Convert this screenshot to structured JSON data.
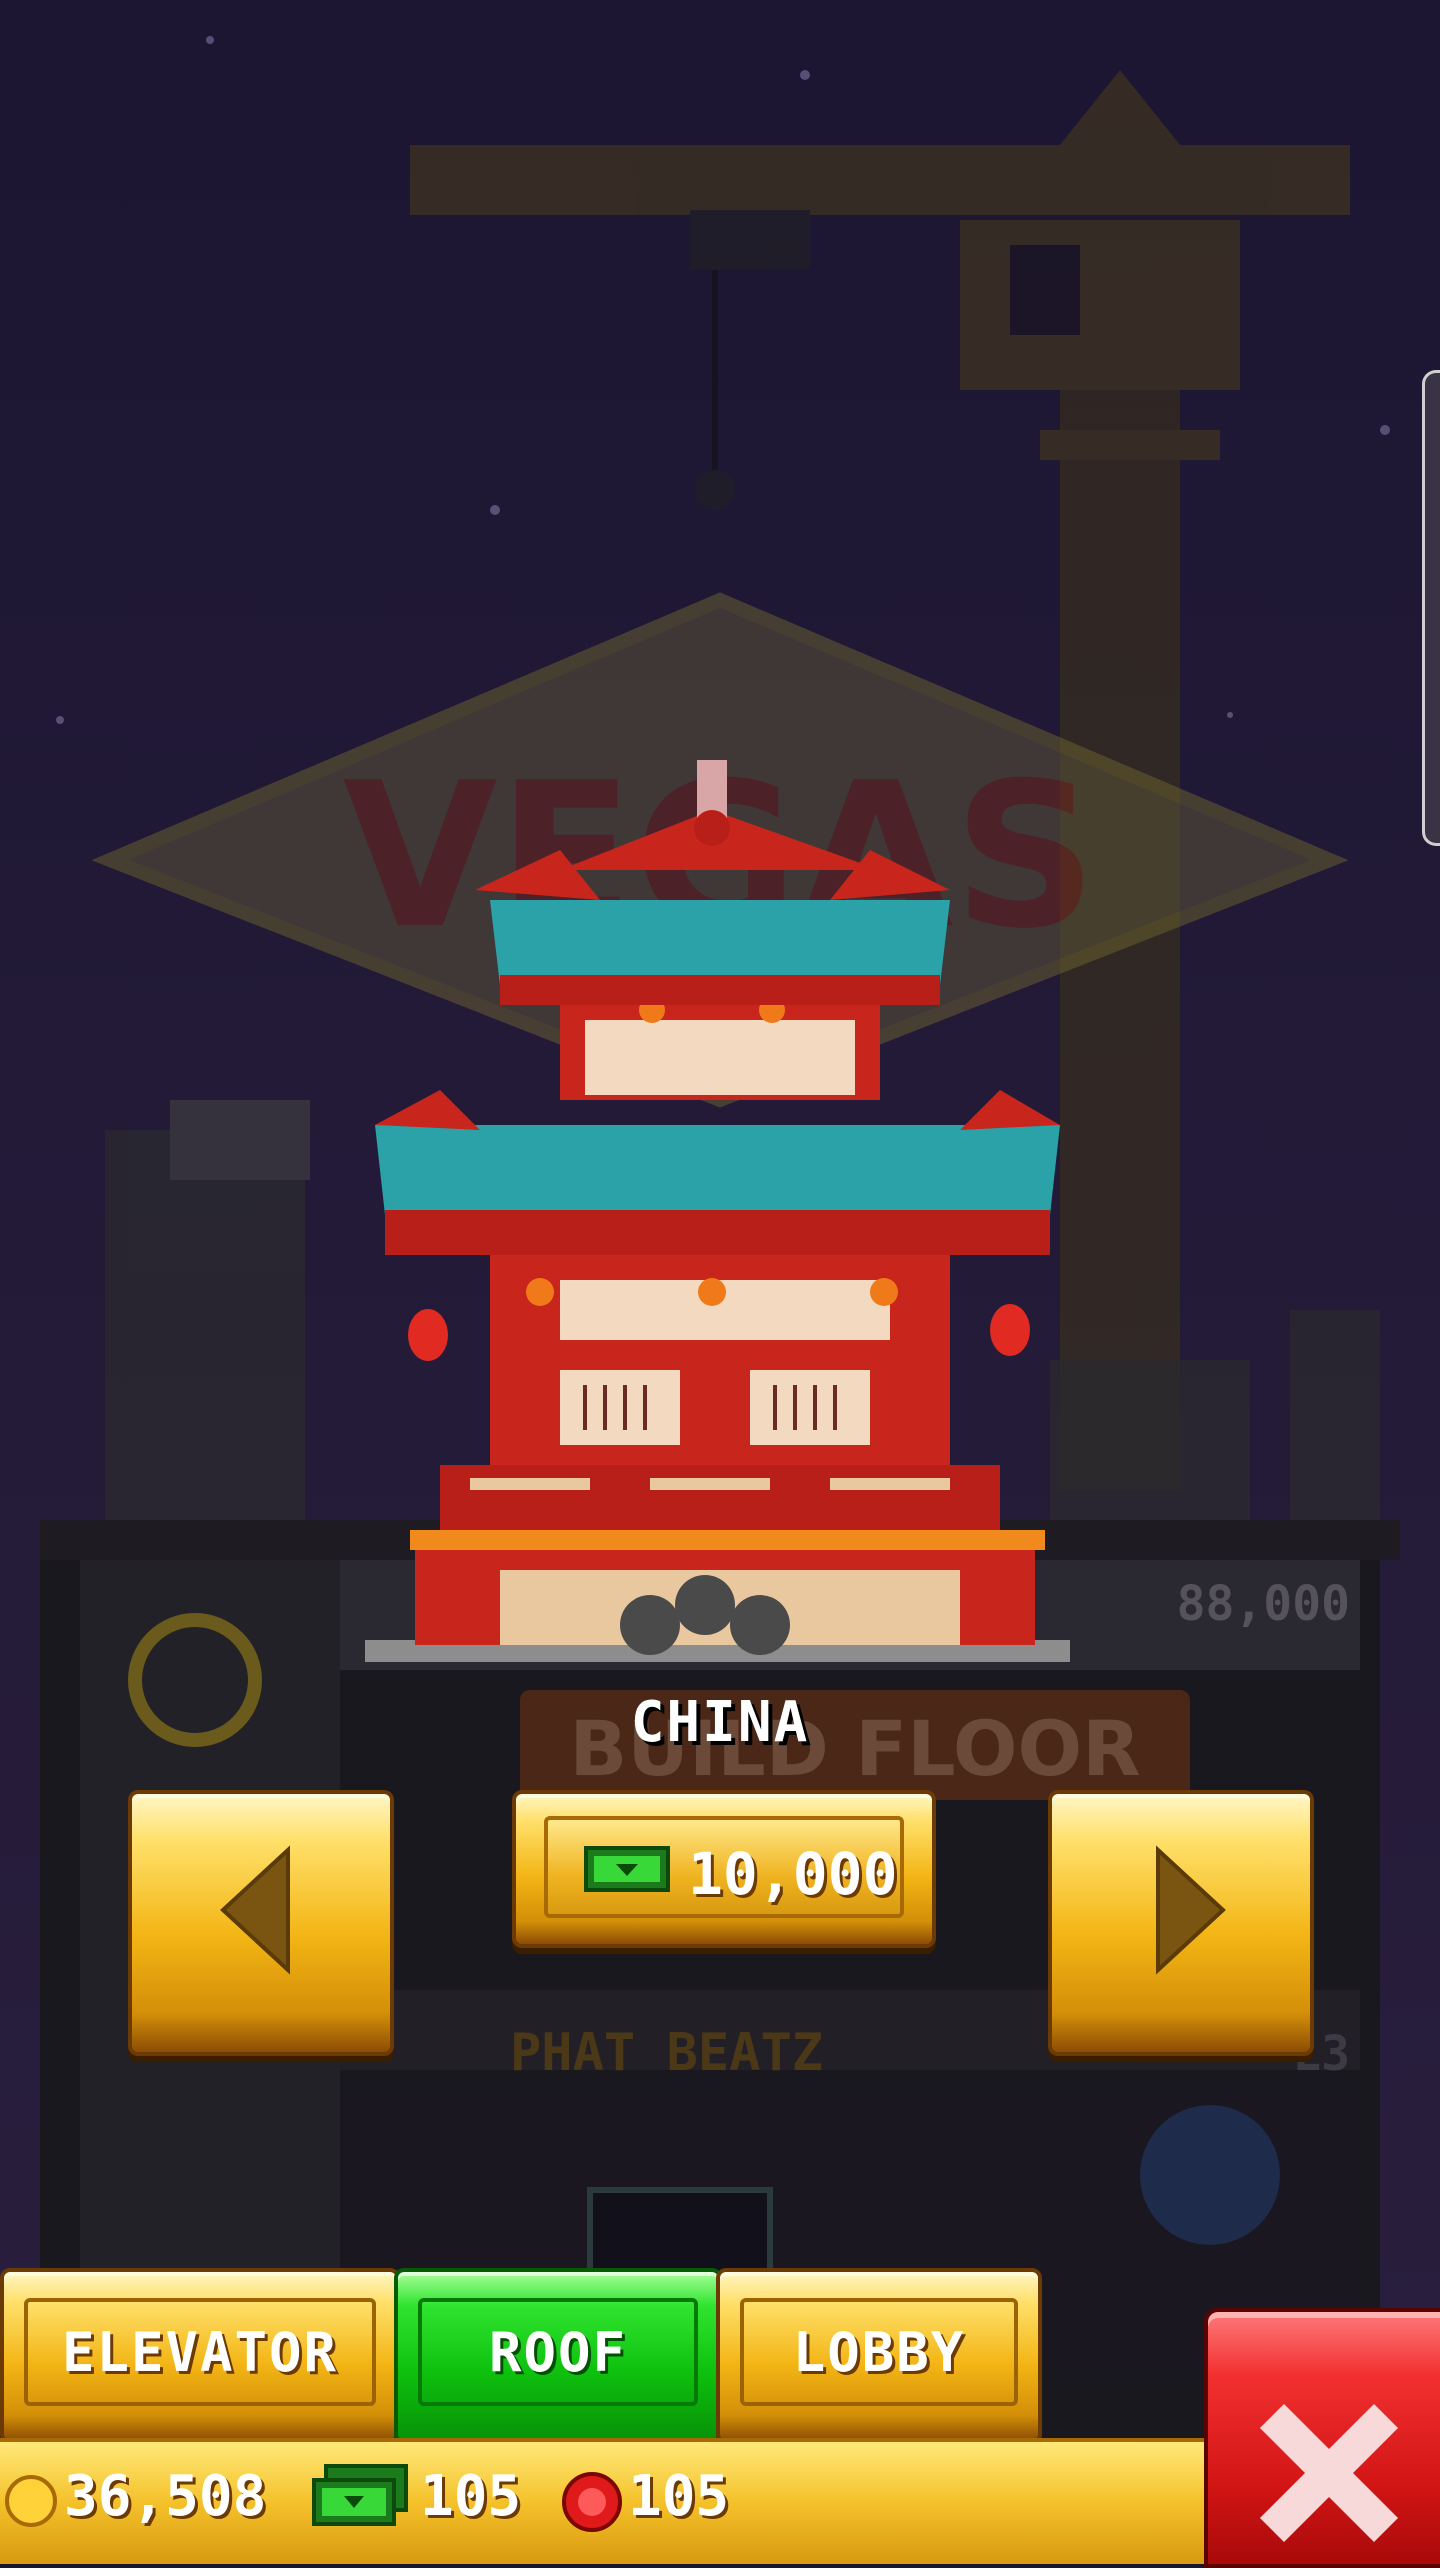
{
  "floor_picker": {
    "name": "CHINA",
    "price": "10,000",
    "price_currency_icon": "bux-icon",
    "prev_icon": "left-arrow-icon",
    "next_icon": "right-arrow-icon"
  },
  "background_text": {
    "sign": "VEGAS",
    "build_floor": "BUILD FLOOR",
    "floor_cost": "88,000",
    "floor_name": "PHAT BEATZ",
    "floor_level": "L3"
  },
  "tabs": {
    "elevator": "ELEVATOR",
    "roof": "ROOF",
    "lobby": "LOBBY",
    "active": "roof"
  },
  "currency": {
    "coins": "36,508",
    "bux": "105",
    "chips": "105"
  },
  "close_icon": "close-x-icon",
  "colors": {
    "gold_button": "#f3b515",
    "roof_tab_active": "#0ec00e",
    "close_button": "#d11414",
    "sky": "#1c1530"
  }
}
